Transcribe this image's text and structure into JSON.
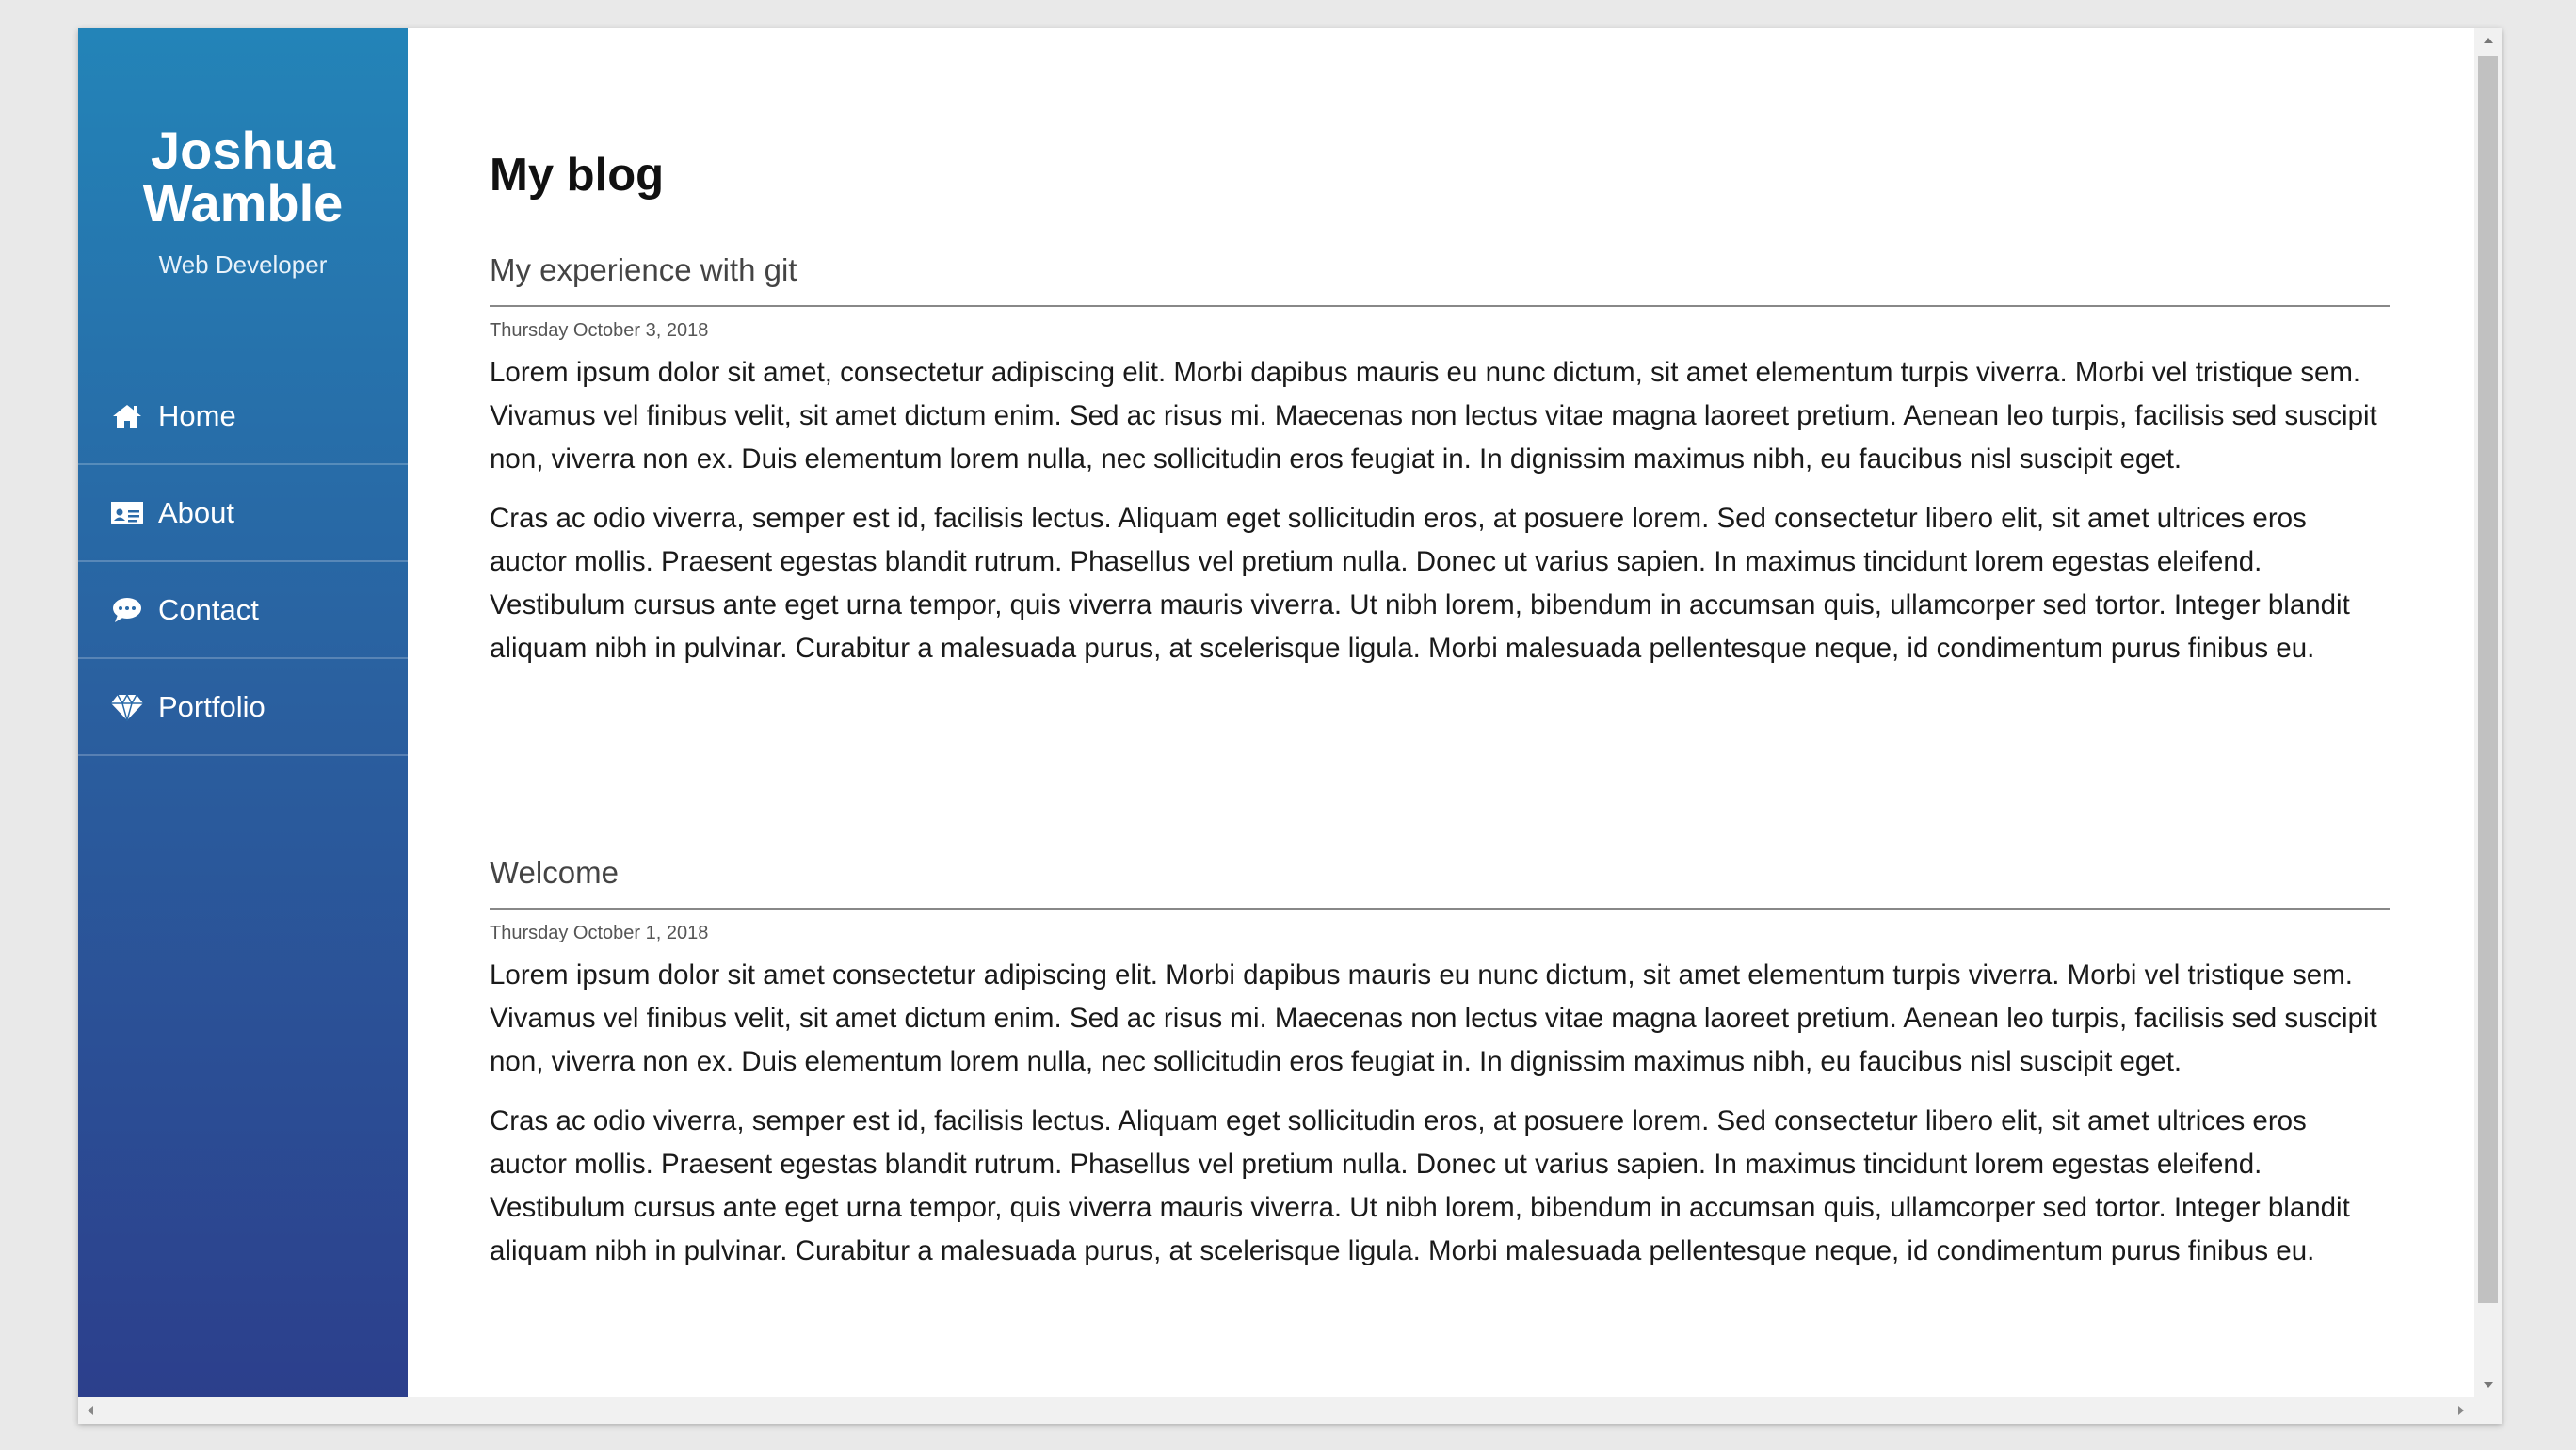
{
  "sidebar": {
    "name_line1": "Joshua",
    "name_line2": "Wamble",
    "subtitle": "Web Developer",
    "items": [
      {
        "label": "Home",
        "icon": "home-icon"
      },
      {
        "label": "About",
        "icon": "id-card-icon"
      },
      {
        "label": "Contact",
        "icon": "chat-bubble-icon"
      },
      {
        "label": "Portfolio",
        "icon": "diamond-icon"
      }
    ]
  },
  "main": {
    "title": "My blog",
    "posts": [
      {
        "title": "My experience with git",
        "date": "Thursday October 3, 2018",
        "paragraphs": [
          "Lorem ipsum dolor sit amet, consectetur adipiscing elit. Morbi dapibus mauris eu nunc dictum, sit amet elementum turpis viverra. Morbi vel tristique sem. Vivamus vel finibus velit, sit amet dictum enim. Sed ac risus mi. Maecenas non lectus vitae magna laoreet pretium. Aenean leo turpis, facilisis sed suscipit non, viverra non ex. Duis elementum lorem nulla, nec sollicitudin eros feugiat in. In dignissim maximus nibh, eu faucibus nisl suscipit eget.",
          "Cras ac odio viverra, semper est id, facilisis lectus. Aliquam eget sollicitudin eros, at posuere lorem. Sed consectetur libero elit, sit amet ultrices eros auctor mollis. Praesent egestas blandit rutrum. Phasellus vel pretium nulla. Donec ut varius sapien. In maximus tincidunt lorem egestas eleifend. Vestibulum cursus ante eget urna tempor, quis viverra mauris viverra. Ut nibh lorem, bibendum in accumsan quis, ullamcorper sed tortor. Integer blandit aliquam nibh in pulvinar. Curabitur a malesuada purus, at scelerisque ligula. Morbi malesuada pellentesque neque, id condimentum purus finibus eu."
        ]
      },
      {
        "title": "Welcome",
        "date": "Thursday October 1, 2018",
        "paragraphs": [
          "Lorem ipsum dolor sit amet consectetur adipiscing elit. Morbi dapibus mauris eu nunc dictum, sit amet elementum turpis viverra. Morbi vel tristique sem. Vivamus vel finibus velit, sit amet dictum enim. Sed ac risus mi. Maecenas non lectus vitae magna laoreet pretium. Aenean leo turpis, facilisis sed suscipit non, viverra non ex. Duis elementum lorem nulla, nec sollicitudin eros feugiat in. In dignissim maximus nibh, eu faucibus nisl suscipit eget.",
          "Cras ac odio viverra, semper est id, facilisis lectus. Aliquam eget sollicitudin eros, at posuere lorem. Sed consectetur libero elit, sit amet ultrices eros auctor mollis. Praesent egestas blandit rutrum. Phasellus vel pretium nulla. Donec ut varius sapien. In maximus tincidunt lorem egestas eleifend. Vestibulum cursus ante eget urna tempor, quis viverra mauris viverra. Ut nibh lorem, bibendum in accumsan quis, ullamcorper sed tortor. Integer blandit aliquam nibh in pulvinar. Curabitur a malesuada purus, at scelerisque ligula. Morbi malesuada pellentesque neque, id condimentum purus finibus eu."
        ]
      }
    ]
  },
  "colors": {
    "sidebar_top": "#2384b8",
    "sidebar_bottom": "#2c3f8c",
    "text": "#1a1a1a",
    "divider": "#888888"
  }
}
